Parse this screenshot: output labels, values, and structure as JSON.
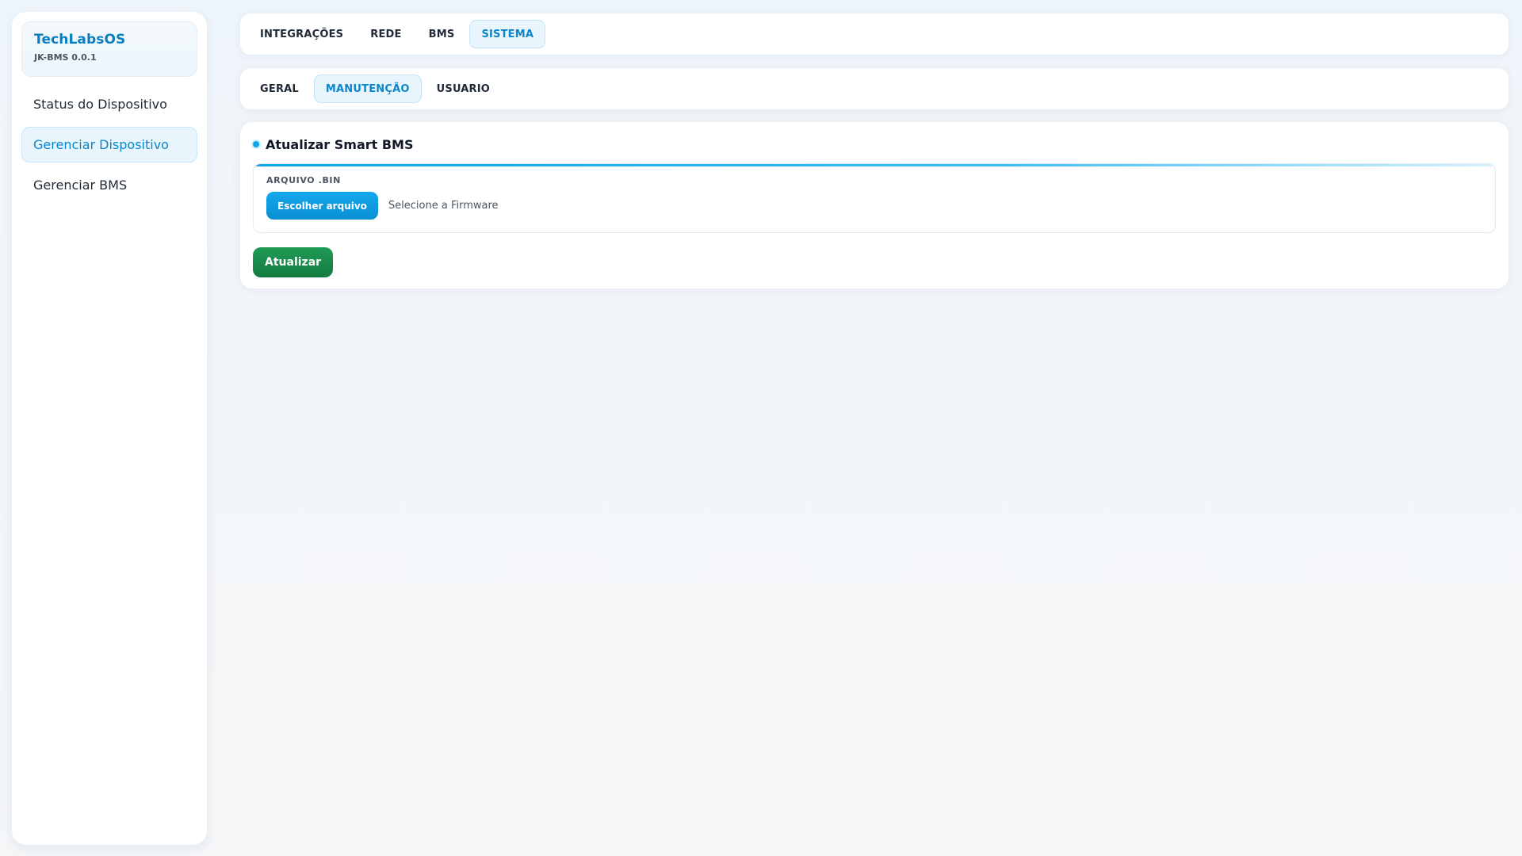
{
  "brand": {
    "name": "TechLabsOS",
    "version": "JK-BMS 0.0.1"
  },
  "sidebar": {
    "items": [
      {
        "label": "Status do Dispositivo",
        "active": false
      },
      {
        "label": "Gerenciar Dispositivo",
        "active": true
      },
      {
        "label": "Gerenciar BMS",
        "active": false
      }
    ]
  },
  "top_tabs": {
    "items": [
      {
        "label": "INTEGRAÇÕES",
        "active": false
      },
      {
        "label": "REDE",
        "active": false
      },
      {
        "label": "BMS",
        "active": false
      },
      {
        "label": "SISTEMA",
        "active": true
      }
    ]
  },
  "sub_tabs": {
    "items": [
      {
        "label": "GERAL",
        "active": false
      },
      {
        "label": "MANUTENÇÃO",
        "active": true
      },
      {
        "label": "USUARIO",
        "active": false
      }
    ]
  },
  "update_panel": {
    "title": "Atualizar Smart BMS",
    "file_label": "ARQUIVO .BIN",
    "choose_button": "Escolher arquivo",
    "file_hint": "Selecione a Firmware",
    "submit_button": "Atualizar"
  },
  "colors": {
    "accent": "#0a86c9",
    "active_bg": "#e8f5fc",
    "success": "#1a8a4b"
  }
}
